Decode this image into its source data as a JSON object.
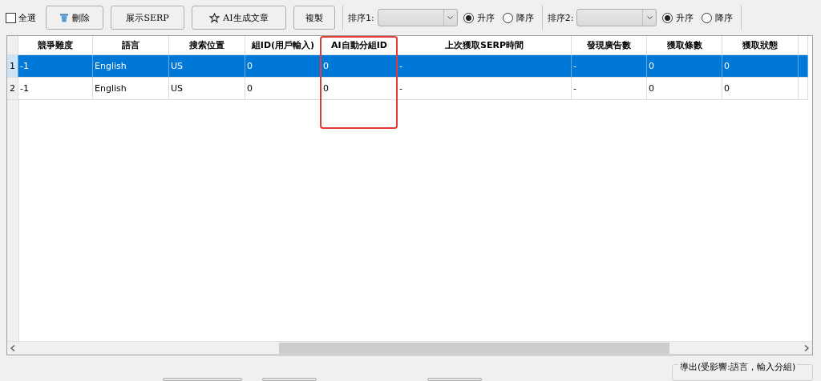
{
  "toolbar": {
    "select_all": {
      "label": "全選",
      "checked": false
    },
    "buttons": [
      {
        "label": "刪除"
      },
      {
        "label": "展示SERP"
      },
      {
        "label": "AI生成文章"
      },
      {
        "label": "複製"
      }
    ],
    "sorts": [
      {
        "label": "排序1:",
        "options": [
          {
            "label": "升序",
            "selected": true
          },
          {
            "label": "降序",
            "selected": false
          }
        ]
      },
      {
        "label": "排序2:",
        "options": [
          {
            "label": "升序",
            "selected": true
          },
          {
            "label": "降序",
            "selected": false
          }
        ]
      }
    ]
  },
  "table": {
    "columns": [
      {
        "label": "競爭難度",
        "highlighted": false
      },
      {
        "label": "語言",
        "highlighted": false
      },
      {
        "label": "搜索位置",
        "highlighted": false
      },
      {
        "label": "組ID(用戶輸入)",
        "highlighted": false
      },
      {
        "label": "AI自動分組ID",
        "highlighted": true
      },
      {
        "label": "上次獲取SERP時間",
        "highlighted": false
      },
      {
        "label": "發現廣告數",
        "highlighted": false
      },
      {
        "label": "獲取條數",
        "highlighted": false
      },
      {
        "label": "獲取狀態",
        "highlighted": false
      }
    ],
    "rows": [
      {
        "number": "1",
        "selected": true,
        "cells": [
          "-1",
          "English",
          "US",
          "0",
          "0",
          "-",
          "-",
          "0",
          "0"
        ]
      },
      {
        "number": "2",
        "selected": false,
        "cells": [
          "-1",
          "English",
          "US",
          "0",
          "0",
          "-",
          "-",
          "0",
          "0"
        ]
      }
    ]
  },
  "export_group": {
    "title": "導出(受影響:語言，輸入分組)"
  }
}
